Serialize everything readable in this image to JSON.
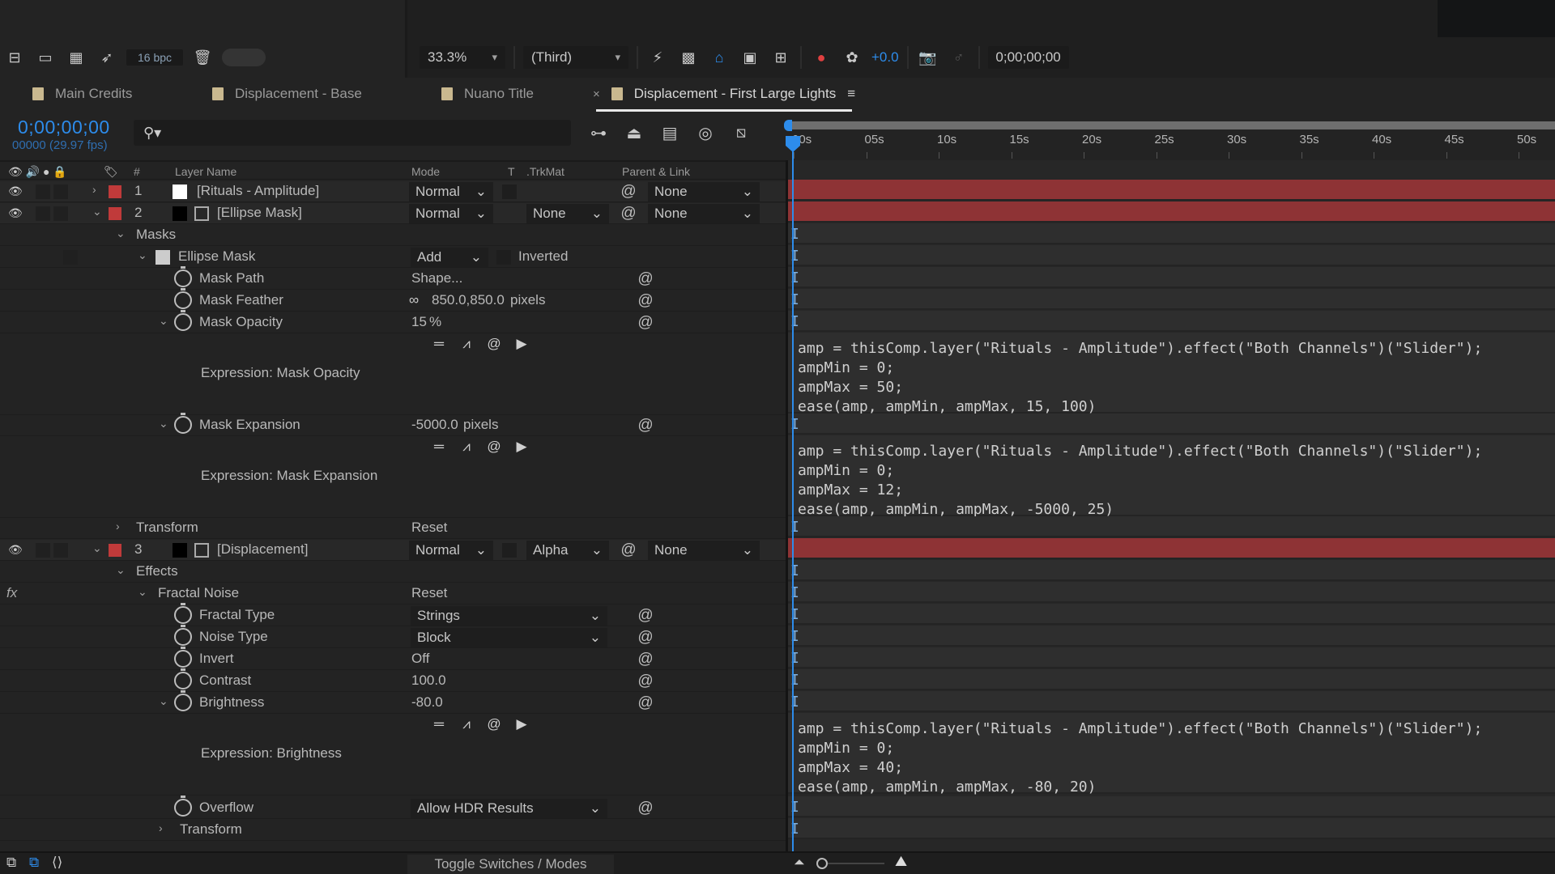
{
  "toolbar": {
    "bit_depth": "16 bpc",
    "zoom": "33.3%",
    "resolution": "(Third)",
    "exposure": "+0.0",
    "current_time": "0;00;00;00",
    "icons": [
      "composition-mini-flowchart-icon",
      "folder-icon",
      "project-settings-icon",
      "render-rocket-icon",
      "trash-icon"
    ]
  },
  "tabs": [
    {
      "label": "Main Credits",
      "active": false
    },
    {
      "label": "Displacement - Base",
      "active": false
    },
    {
      "label": "Nuano Title",
      "active": false
    },
    {
      "label": "Displacement - First Large Lights",
      "active": true
    }
  ],
  "timeline": {
    "current_time": "0;00;00;00",
    "frame_fps": "00000 (29.97 fps)",
    "search_placeholder": "",
    "ruler": [
      "00s",
      "05s",
      "10s",
      "15s",
      "20s",
      "25s",
      "30s",
      "35s",
      "40s",
      "45s",
      "50s"
    ],
    "columns": {
      "layer_name": "Layer Name",
      "mode": "Mode",
      "t": "T",
      "trkmat": ".TrkMat",
      "parent": "Parent & Link",
      "num": "#"
    }
  },
  "colors": {
    "accent": "#2d8ceb",
    "label_red": "#c03a3a",
    "bar_red": "#8e3335",
    "value_red": "#e0403a"
  },
  "rows": {
    "l1": {
      "num": "1",
      "name": "[Rituals - Amplitude]",
      "mode": "Normal",
      "parent": "None"
    },
    "l2": {
      "num": "2",
      "name": "[Ellipse Mask]",
      "mode": "Normal",
      "trkmat": "None",
      "parent": "None"
    },
    "masks": "Masks",
    "ellipse_mask": {
      "name": "Ellipse Mask",
      "mode": "Add",
      "inverted": "Inverted"
    },
    "mask_path": {
      "name": "Mask Path",
      "value": "Shape..."
    },
    "mask_feather": {
      "name": "Mask Feather",
      "value": "850.0,850.0",
      "unit": "pixels"
    },
    "mask_opacity": {
      "name": "Mask Opacity",
      "value": "15",
      "unit": "%"
    },
    "expr_mask_opacity": "Expression: Mask Opacity",
    "mask_expansion": {
      "name": "Mask Expansion",
      "value": "-5000.0",
      "unit": "pixels"
    },
    "expr_mask_expansion": "Expression: Mask Expansion",
    "transform1": {
      "name": "Transform",
      "value": "Reset"
    },
    "l3": {
      "num": "3",
      "name": "[Displacement]",
      "mode": "Normal",
      "trkmat": "Alpha",
      "parent": "None"
    },
    "effects": "Effects",
    "fractal_noise": {
      "name": "Fractal Noise",
      "value": "Reset"
    },
    "fractal_type": {
      "name": "Fractal Type",
      "value": "Strings"
    },
    "noise_type": {
      "name": "Noise Type",
      "value": "Block"
    },
    "invert": {
      "name": "Invert",
      "value": "Off"
    },
    "contrast": {
      "name": "Contrast",
      "value": "100.0"
    },
    "brightness": {
      "name": "Brightness",
      "value": "-80.0"
    },
    "expr_brightness": "Expression: Brightness",
    "overflow": {
      "name": "Overflow",
      "value": "Allow HDR Results"
    },
    "transform2": {
      "name": "Transform"
    }
  },
  "expressions": {
    "mask_opacity": "amp = thisComp.layer(\"Rituals - Amplitude\").effect(\"Both Channels\")(\"Slider\");\nampMin = 0;\nampMax = 50;\nease(amp, ampMin, ampMax, 15, 100)",
    "mask_expansion": "amp = thisComp.layer(\"Rituals - Amplitude\").effect(\"Both Channels\")(\"Slider\");\nampMin = 0;\nampMax = 12;\nease(amp, ampMin, ampMax, -5000, 25)",
    "brightness": "amp = thisComp.layer(\"Rituals - Amplitude\").effect(\"Both Channels\")(\"Slider\");\nampMin = 0;\nampMax = 40;\nease(amp, ampMin, ampMax, -80, 20)"
  },
  "bottom": {
    "toggle": "Toggle Switches / Modes"
  }
}
